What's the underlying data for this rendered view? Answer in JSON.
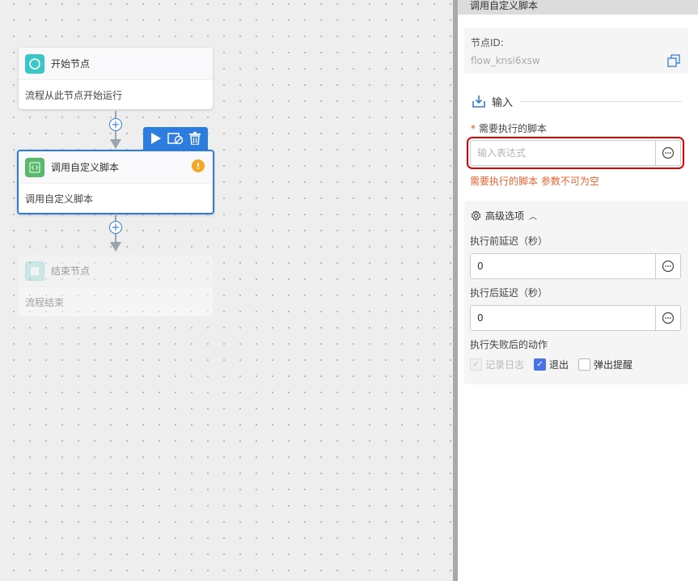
{
  "canvas": {
    "nodes": [
      {
        "title": "开始节点",
        "description": "流程从此节点开始运行"
      },
      {
        "title": "调用自定义脚本",
        "description": "调用自定义脚本",
        "warning": "!"
      },
      {
        "title": "结束节点",
        "description": "流程结束"
      }
    ],
    "connector_plus": "+"
  },
  "panel": {
    "title": "调用自定义脚本",
    "node_id_label": "节点ID:",
    "node_id_value": "flow_knsi6xsw",
    "input_section": {
      "title": "输入",
      "script_field": {
        "required_mark": "*",
        "label": "需要执行的脚本",
        "placeholder": "输入表达式",
        "value": "",
        "error": "需要执行的脚本 参数不可为空"
      }
    },
    "advanced": {
      "title": "高级选项",
      "delay_before_label": "执行前延迟（秒）",
      "delay_before_value": "0",
      "delay_after_label": "执行后延迟（秒）",
      "delay_after_value": "0",
      "on_failure_label": "执行失败后的动作",
      "options": [
        {
          "label": "记录日志",
          "checked": true,
          "disabled": true
        },
        {
          "label": "退出",
          "checked": true,
          "disabled": false
        },
        {
          "label": "弹出提醒",
          "checked": false,
          "disabled": false
        }
      ]
    }
  },
  "colors": {
    "accent": "#2d7ce0",
    "error": "#e6622f",
    "warning": "#f5a623",
    "checkbox": "#4a72e8"
  }
}
